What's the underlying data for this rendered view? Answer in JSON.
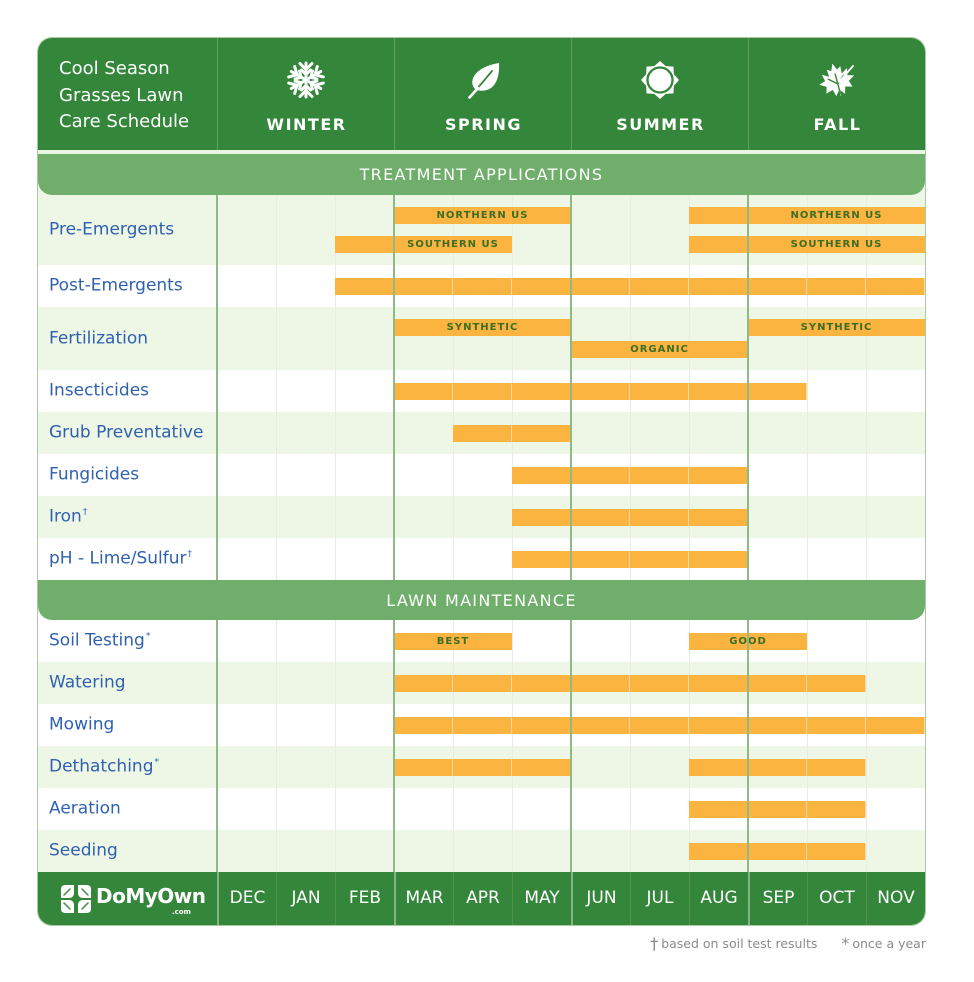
{
  "header": {
    "title_lines": [
      "Cool Season",
      "Grasses Lawn",
      "Care Schedule"
    ]
  },
  "chart_data": {
    "type": "bar",
    "orientation": "horizontal-range",
    "title": "Cool Season Grasses Lawn Care Schedule",
    "xlabel": "",
    "ylabel": "",
    "x": [
      "DEC",
      "JAN",
      "FEB",
      "MAR",
      "APR",
      "MAY",
      "JUN",
      "JUL",
      "AUG",
      "SEP",
      "OCT",
      "NOV"
    ],
    "x_groups": [
      {
        "name": "WINTER",
        "icon": "snowflake-icon",
        "months": [
          "DEC",
          "JAN",
          "FEB"
        ]
      },
      {
        "name": "SPRING",
        "icon": "leaf-icon",
        "months": [
          "MAR",
          "APR",
          "MAY"
        ]
      },
      {
        "name": "SUMMER",
        "icon": "sun-icon",
        "months": [
          "JUN",
          "JUL",
          "AUG"
        ]
      },
      {
        "name": "FALL",
        "icon": "maple-leaf-icon",
        "months": [
          "SEP",
          "OCT",
          "NOV"
        ]
      }
    ],
    "grid": true,
    "sections": [
      {
        "title": "TREATMENT APPLICATIONS",
        "rows": [
          {
            "label": "Pre-Emergents",
            "mark": "",
            "tracks": 2,
            "bars": [
              {
                "track": 0,
                "from": "MAR",
                "to": "MAY",
                "label": "NORTHERN US"
              },
              {
                "track": 0,
                "from": "AUG",
                "to": "NOV",
                "label": "NORTHERN US",
                "label_from": "SEP",
                "label_to": "NOV"
              },
              {
                "track": 1,
                "from": "FEB",
                "to": "APR",
                "label": "SOUTHERN US",
                "label_from": "MAR",
                "label_to": "APR"
              },
              {
                "track": 1,
                "from": "AUG",
                "to": "NOV",
                "label": "SOUTHERN US",
                "label_from": "SEP",
                "label_to": "NOV"
              }
            ]
          },
          {
            "label": "Post-Emergents",
            "mark": "",
            "tracks": 1,
            "bars": [
              {
                "from": "FEB",
                "to": "NOV"
              }
            ]
          },
          {
            "label": "Fertilization",
            "mark": "",
            "tracks": 2,
            "bars": [
              {
                "track": 0,
                "from": "MAR",
                "to": "MAY",
                "label": "SYNTHETIC"
              },
              {
                "track": 1,
                "from": "JUN",
                "to": "AUG",
                "label": "ORGANIC"
              },
              {
                "track": 0,
                "from": "SEP",
                "to": "NOV",
                "label": "SYNTHETIC"
              }
            ]
          },
          {
            "label": "Insecticides",
            "mark": "",
            "tracks": 1,
            "bars": [
              {
                "from": "MAR",
                "to": "SEP"
              }
            ]
          },
          {
            "label": "Grub Preventative",
            "mark": "",
            "tracks": 1,
            "bars": [
              {
                "from": "APR",
                "to": "MAY"
              }
            ]
          },
          {
            "label": "Fungicides",
            "mark": "",
            "tracks": 1,
            "bars": [
              {
                "from": "MAY",
                "to": "AUG"
              }
            ]
          },
          {
            "label": "Iron",
            "mark": "†",
            "tracks": 1,
            "bars": [
              {
                "from": "MAY",
                "to": "AUG"
              }
            ]
          },
          {
            "label": "pH - Lime/Sulfur",
            "mark": "†",
            "tracks": 1,
            "bars": [
              {
                "from": "MAY",
                "to": "AUG"
              }
            ]
          }
        ]
      },
      {
        "title": "LAWN MAINTENANCE",
        "rows": [
          {
            "label": "Soil Testing",
            "mark": "*",
            "tracks": 1,
            "bars": [
              {
                "from": "MAR",
                "to": "APR",
                "label": "BEST"
              },
              {
                "from": "AUG",
                "to": "SEP",
                "label": "GOOD"
              }
            ]
          },
          {
            "label": "Watering",
            "mark": "",
            "tracks": 1,
            "bars": [
              {
                "from": "MAR",
                "to": "OCT"
              }
            ]
          },
          {
            "label": "Mowing",
            "mark": "",
            "tracks": 1,
            "bars": [
              {
                "from": "MAR",
                "to": "NOV"
              }
            ]
          },
          {
            "label": "Dethatching",
            "mark": "*",
            "tracks": 1,
            "bars": [
              {
                "from": "MAR",
                "to": "MAY"
              },
              {
                "from": "AUG",
                "to": "OCT"
              }
            ]
          },
          {
            "label": "Aeration",
            "mark": "",
            "tracks": 1,
            "bars": [
              {
                "from": "AUG",
                "to": "OCT"
              }
            ]
          },
          {
            "label": "Seeding",
            "mark": "",
            "tracks": 1,
            "bars": [
              {
                "from": "AUG",
                "to": "OCT"
              }
            ]
          }
        ]
      }
    ]
  },
  "footer": {
    "logo_text": "DoMyOwn",
    "logo_sub": ".com"
  },
  "footnotes": [
    {
      "mark": "†",
      "text": "based on soil test results"
    },
    {
      "mark": "*",
      "text": "once a year"
    }
  ],
  "colors": {
    "header_green": "#33863a",
    "band_green": "#6fae6b",
    "row_light_green": "#eef7e6",
    "bar_orange": "#fbb440",
    "row_label_blue": "#2f61b0",
    "bar_label_green": "#3d6d24",
    "season_line": "#8fba87"
  }
}
